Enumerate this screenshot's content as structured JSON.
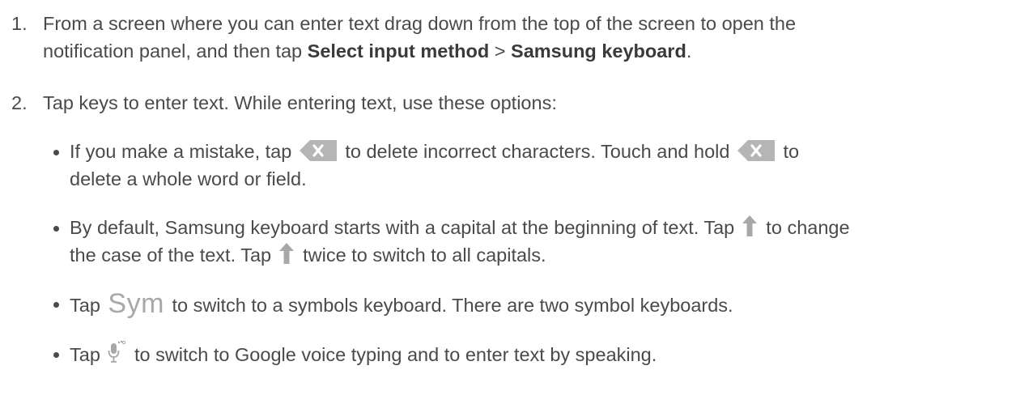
{
  "steps": [
    {
      "number": "1.",
      "line1": "From a screen where you can enter text drag down from the top of the screen to open the",
      "line2_pre": "notification panel, and then tap ",
      "line2_bold1": "Select input method",
      "line2_mid": " > ",
      "line2_bold2": "Samsung keyboard",
      "line2_post": "."
    },
    {
      "number": "2.",
      "text": "Tap keys to enter text. While entering text, use these options:"
    }
  ],
  "bullets": {
    "delete": {
      "part1": "If you make a mistake, tap ",
      "part2": " to delete incorrect characters. Touch and hold ",
      "part3": " to",
      "line2": "delete a whole word or field.",
      "icon": "delete-key-icon"
    },
    "shift": {
      "part1": "By default, Samsung keyboard starts with a capital at the beginning of text. Tap ",
      "part2": " to change",
      "line2_pre": "the case of the text. Tap ",
      "line2_post": " twice to switch to all capitals.",
      "icon": "shift-arrow-icon"
    },
    "sym": {
      "pre": "Tap ",
      "key_label": "Sym",
      "post": " to switch to a symbols keyboard. There are two symbol keyboards."
    },
    "voice": {
      "pre": "Tap ",
      "post": " to switch to Google voice typing and to enter text by speaking.",
      "icon": "microphone-icon"
    }
  },
  "colors": {
    "text": "#4a4a4a",
    "icon_gray": "#a8a8a8"
  }
}
